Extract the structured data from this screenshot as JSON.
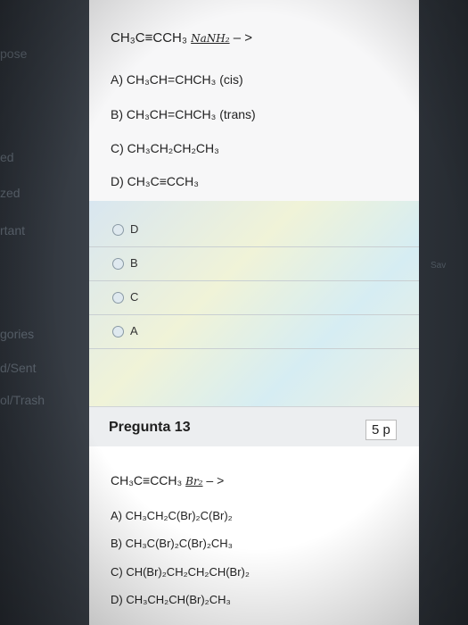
{
  "sidebar": {
    "fragments": [
      "pose",
      "ed",
      "zed",
      "rtant",
      "gories",
      "d/Sent",
      "ol/Trash"
    ]
  },
  "right_fragment": "Sav",
  "question12": {
    "reactant": "CH₃C≡CCH₃",
    "reagent": "NaNH₂",
    "arrow": "– >",
    "options": [
      "A) CH₃CH=CHCH₃ (cis)",
      "B) CH₃CH=CHCH₃ (trans)",
      "C) CH₃CH₂CH₂CH₃",
      "D) CH₃C≡CCH₃"
    ],
    "answers": [
      "D",
      "B",
      "C",
      "A"
    ]
  },
  "question13": {
    "title": "Pregunta 13",
    "points": "5 p",
    "reactant": "CH₃C≡CCH₃",
    "reagent": "Br₂",
    "arrow": "– >",
    "options": [
      "A) CH₃CH₂C(Br)₂C(Br)₂",
      "B) CH₃C(Br)₂C(Br)₂CH₃",
      "C) CH(Br)₂CH₂CH₂CH(Br)₂",
      "D) CH₃CH₂CH(Br)₂CH₃"
    ]
  }
}
